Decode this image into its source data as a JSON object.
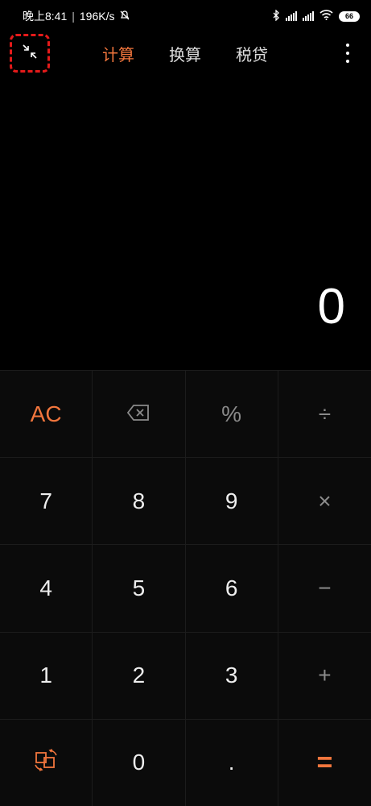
{
  "status_bar": {
    "time": "晚上8:41",
    "separator": "|",
    "net_speed": "196K/s",
    "battery": "66"
  },
  "toolbar": {
    "tabs": [
      {
        "label": "计算",
        "active": true
      },
      {
        "label": "换算",
        "active": false
      },
      {
        "label": "税贷",
        "active": false
      }
    ]
  },
  "display": {
    "value": "0"
  },
  "keypad": {
    "rows": [
      [
        "AC",
        "backspace",
        "%",
        "÷"
      ],
      [
        "7",
        "8",
        "9",
        "×"
      ],
      [
        "4",
        "5",
        "6",
        "−"
      ],
      [
        "1",
        "2",
        "3",
        "+"
      ],
      [
        "rotate",
        "0",
        ".",
        "="
      ]
    ],
    "labels": {
      "ac": "AC",
      "percent": "%",
      "divide": "÷",
      "seven": "7",
      "eight": "8",
      "nine": "9",
      "multiply": "×",
      "four": "4",
      "five": "5",
      "six": "6",
      "minus": "−",
      "one": "1",
      "two": "2",
      "three": "3",
      "plus": "+",
      "zero": "0",
      "dot": ".",
      "equals": "="
    }
  },
  "colors": {
    "accent": "#f2763d",
    "highlight_box": "#e41a1a",
    "background": "#000000",
    "keypad_bg": "#0b0b0b"
  }
}
